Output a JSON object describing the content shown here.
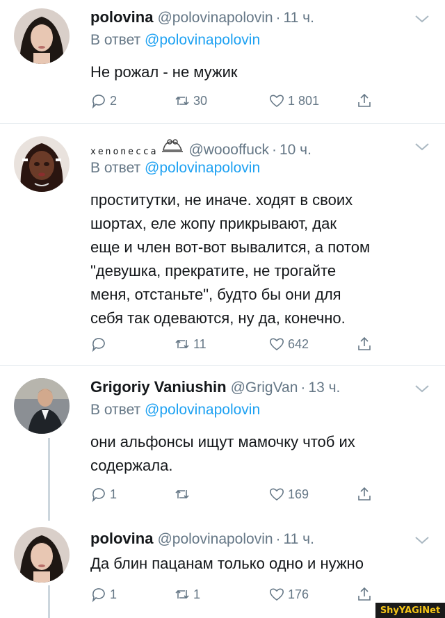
{
  "tweets": [
    {
      "name": "polovina",
      "handle": "@polovinapolovin",
      "time": "11 ч.",
      "reply_prefix": "В ответ ",
      "reply_mention": "@polovinapolovin",
      "text": "Не рожал - не мужик",
      "comments": "2",
      "retweets": "30",
      "likes": "1 801"
    },
    {
      "name": "xenonecca",
      "handle": "@woooffuck",
      "time": "10 ч.",
      "reply_prefix": "В ответ ",
      "reply_mention": "@polovinapolovin",
      "text_lines": [
        "проститутки, не иначе. ходят в своих",
        "шортах, еле жопу прикрывают, дак",
        "еще и член вот-вот вывалится, а потом",
        "\"девушка, прекратите, не трогайте",
        "меня, отстаньте\", будто бы они для",
        "себя так одеваются, ну да, конечно."
      ],
      "comments": "",
      "retweets": "11",
      "likes": "642"
    },
    {
      "name": "Grigoriy Vaniushin",
      "handle": "@GrigVan",
      "time": "13 ч.",
      "reply_prefix": "В ответ ",
      "reply_mention": "@polovinapolovin",
      "text_lines": [
        "они альфонсы ищут мамочку чтоб их",
        "содержала."
      ],
      "comments": "1",
      "retweets": "",
      "likes": "169"
    },
    {
      "name": "polovina",
      "handle": "@polovinapolovin",
      "time": "11 ч.",
      "text": "Да блин пацанам только одно и нужно",
      "comments": "1",
      "retweets": "1",
      "likes": "176"
    }
  ],
  "dot": "·",
  "watermark": "ShyYAGiNet",
  "colors": {
    "accent": "#1da1f2",
    "muted": "#657786",
    "text": "#14171a",
    "divider": "#e6ecf0"
  },
  "icons": [
    "comment-icon",
    "retweet-icon",
    "like-icon",
    "share-icon",
    "chevron-down-icon",
    "frog-icon"
  ]
}
